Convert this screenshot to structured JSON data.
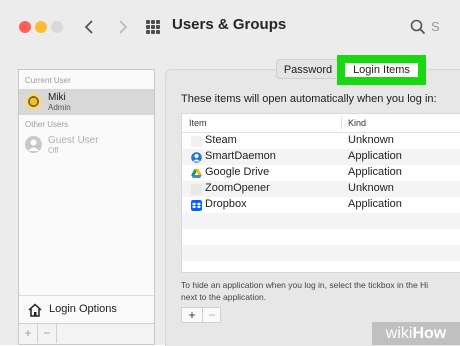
{
  "window": {
    "title": "Users & Groups",
    "search_placeholder": "S"
  },
  "sidebar": {
    "current_user_label": "Current User",
    "other_users_label": "Other Users",
    "users": [
      {
        "name": "Miki",
        "role": "Admin",
        "selected": true
      },
      {
        "name": "Guest User",
        "role": "Off",
        "selected": false
      }
    ],
    "login_options_label": "Login Options",
    "add_label": "+",
    "remove_label": "−"
  },
  "tabs": [
    {
      "label": "Password",
      "active": false
    },
    {
      "label": "Login Items",
      "active": true
    }
  ],
  "main": {
    "description": "These items will open automatically when you log in:",
    "columns": {
      "item": "Item",
      "kind": "Kind"
    },
    "rows": [
      {
        "name": "Steam",
        "kind": "Unknown",
        "icon": "blank-icon"
      },
      {
        "name": "SmartDaemon",
        "kind": "Application",
        "icon": "smartdaemon-icon"
      },
      {
        "name": "Google Drive",
        "kind": "Application",
        "icon": "google-drive-icon"
      },
      {
        "name": "ZoomOpener",
        "kind": "Unknown",
        "icon": "blank-icon"
      },
      {
        "name": "Dropbox",
        "kind": "Application",
        "icon": "dropbox-icon"
      }
    ],
    "hint": "To hide an application when you log in, select the tickbox in the Hi next to the application.",
    "hint_line1": "To hide an application when you log in, select the tickbox in the Hi",
    "hint_line2": "next to the application.",
    "add_label": "+",
    "remove_label": "−"
  },
  "watermark": {
    "part1": "wiki",
    "part2": "How"
  },
  "colors": {
    "highlight": "#19d812",
    "selected_row": "#d8d8d8"
  }
}
